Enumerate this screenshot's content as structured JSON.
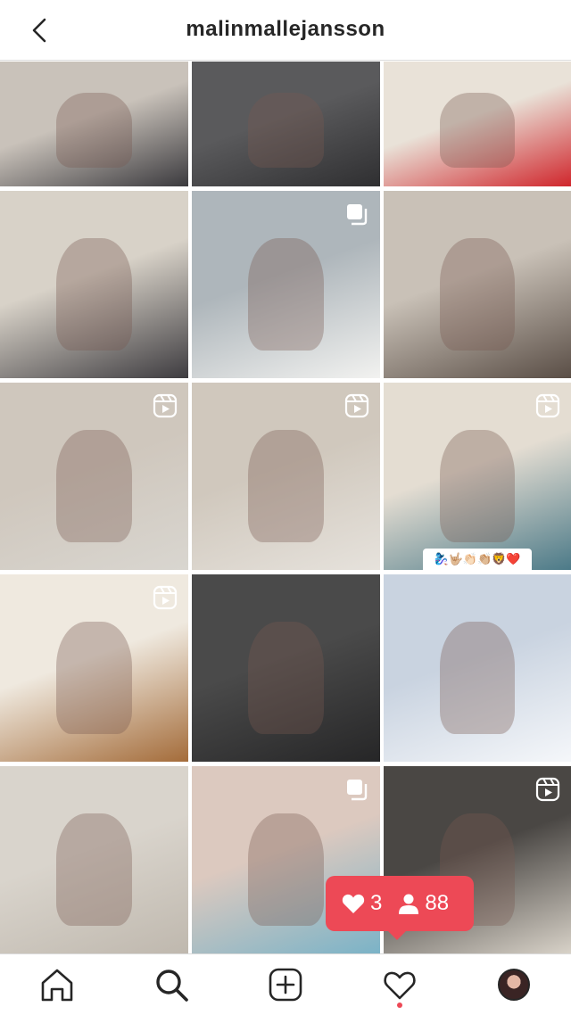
{
  "header": {
    "username": "malinmallejansson",
    "back_icon": "chevron-left-icon"
  },
  "grid": {
    "posts": [
      {
        "kind": "photo",
        "colors": [
          "#c9c2ba",
          "#3b3a3e"
        ],
        "badge": ""
      },
      {
        "kind": "photo",
        "colors": [
          "#5a5a5c",
          "#2f2f31"
        ],
        "badge": ""
      },
      {
        "kind": "photo",
        "colors": [
          "#e9e2d8",
          "#d0262c"
        ],
        "badge": ""
      },
      {
        "kind": "photo",
        "colors": [
          "#d8d2c8",
          "#3e3c40"
        ],
        "badge": ""
      },
      {
        "kind": "photo",
        "colors": [
          "#aeb6bb",
          "#f2f2f0"
        ],
        "badge": "carousel"
      },
      {
        "kind": "photo",
        "colors": [
          "#c9c1b7",
          "#5a4e46"
        ],
        "badge": ""
      },
      {
        "kind": "reel",
        "colors": [
          "#cfc7bd",
          "#d9d6d0"
        ],
        "badge": "reel"
      },
      {
        "kind": "reel",
        "colors": [
          "#d0c8bd",
          "#e6e2dc"
        ],
        "badge": "reel"
      },
      {
        "kind": "reel",
        "colors": [
          "#e4ddd2",
          "#4c7a88"
        ],
        "badge": "reel"
      },
      {
        "kind": "reel",
        "colors": [
          "#efe9df",
          "#a46c3a"
        ],
        "badge": "reel"
      },
      {
        "kind": "photo",
        "colors": [
          "#4a4a4a",
          "#262627"
        ],
        "badge": ""
      },
      {
        "kind": "photo",
        "colors": [
          "#c9d3e0",
          "#f5f7fa"
        ],
        "badge": ""
      },
      {
        "kind": "photo",
        "colors": [
          "#d9d4cc",
          "#bfb8ae"
        ],
        "badge": ""
      },
      {
        "kind": "photo",
        "colors": [
          "#dcc9bf",
          "#7bb3c7"
        ],
        "badge": "carousel"
      },
      {
        "kind": "reel",
        "colors": [
          "#4a4744",
          "#d8d2c8"
        ],
        "badge": "reel"
      }
    ],
    "emoji_caption": "🧞‍♀️🤟🏼👏🏻👏🏼🦁❤️"
  },
  "activity": {
    "likes": "3",
    "followers": "88",
    "accent": "#ed4956"
  },
  "tabbar": {
    "items": [
      "home-icon",
      "search-icon",
      "new-post-icon",
      "activity-icon",
      "profile-avatar"
    ]
  }
}
